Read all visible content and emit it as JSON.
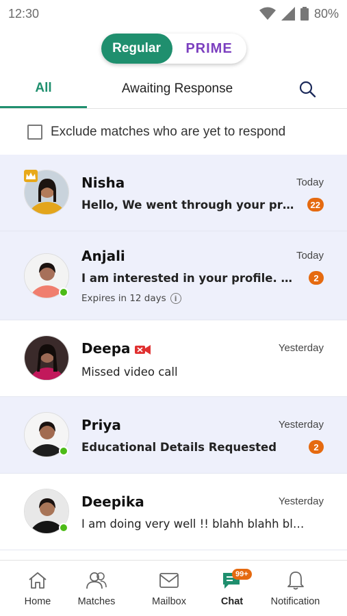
{
  "status_bar": {
    "time": "12:30",
    "battery": "80%"
  },
  "toggle": {
    "regular_label": "Regular",
    "prime_label": "PRIME"
  },
  "tabs": {
    "all": "All",
    "awaiting": "Awaiting Response"
  },
  "exclude": {
    "label": "Exclude matches who are yet to respond",
    "checked": false
  },
  "chats": [
    {
      "name": "Nisha",
      "time": "Today",
      "message": "Hello, We went through your profile a...",
      "badge": "22",
      "unread": true,
      "online": false,
      "premium": true
    },
    {
      "name": "Anjali",
      "time": "Today",
      "message": "I am interested in your profile. Would...",
      "badge": "2",
      "unread": true,
      "online": true,
      "expires": "Expires in 12 days"
    },
    {
      "name": "Deepa",
      "time": "Yesterday",
      "message": "Missed video call",
      "unread": false,
      "online": false,
      "video_icon": true
    },
    {
      "name": "Priya",
      "time": "Yesterday",
      "message": "Educational Details Requested",
      "badge": "2",
      "unread": true,
      "online": true
    },
    {
      "name": "Deepika",
      "time": "Yesterday",
      "message": "I am doing very well !! blahh blahh blah...",
      "unread": false,
      "online": true
    }
  ],
  "bottom_nav": {
    "home": "Home",
    "matches": "Matches",
    "mailbox": "Mailbox",
    "chat": "Chat",
    "chat_badge": "99+",
    "notification": "Notification"
  },
  "colors": {
    "accent": "#1f8f6e",
    "prime": "#7b3fbf",
    "badge": "#e56a10",
    "online": "#4cbb17",
    "unread_bg": "#eef0fb"
  }
}
